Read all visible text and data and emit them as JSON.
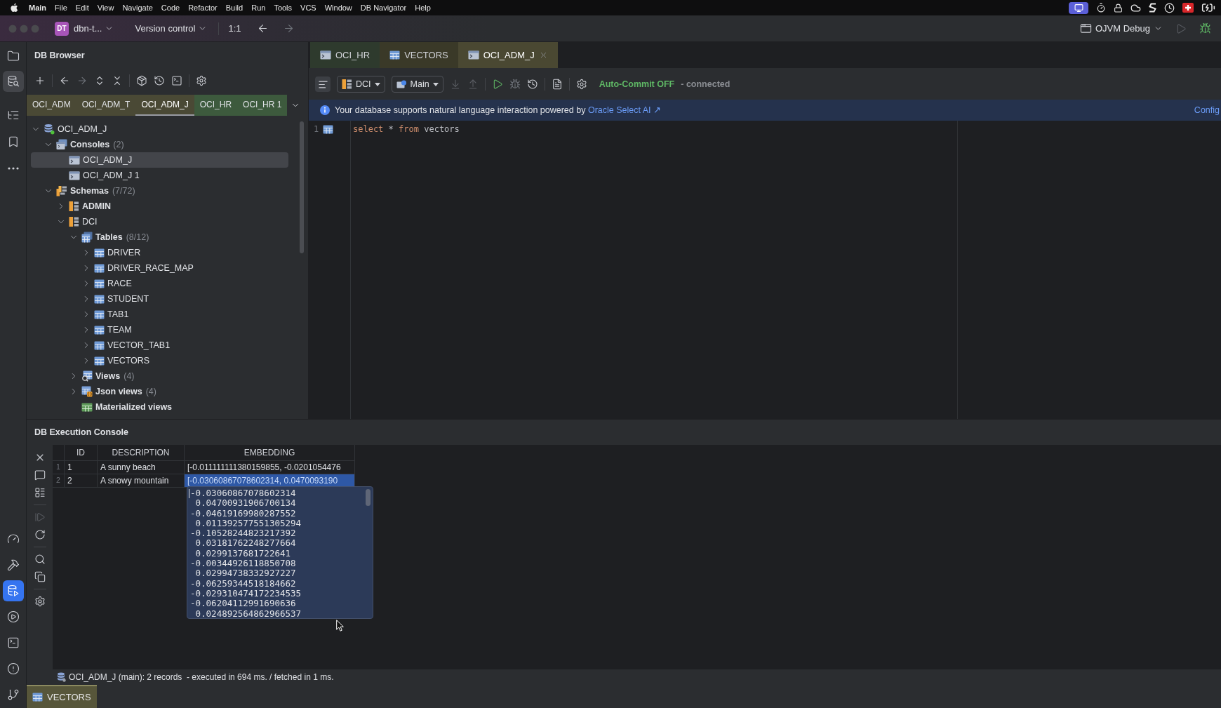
{
  "menu_bar": {
    "app": "Main",
    "items": [
      "File",
      "Edit",
      "View",
      "Navigate",
      "Code",
      "Refactor",
      "Build",
      "Run",
      "Tools",
      "VCS",
      "Window",
      "DB Navigator",
      "Help"
    ]
  },
  "toolbar": {
    "project_initials": "DT",
    "project": "dbn-t...",
    "vcs": "Version control",
    "position": "1:1",
    "run_config": "OJVM Debug"
  },
  "tool_strip": {
    "top": [
      {
        "kind": "project",
        "selected": false
      },
      {
        "kind": "db-browser",
        "selected": true
      },
      {
        "kind": "structure",
        "selected": false
      },
      {
        "kind": "bookmarks",
        "selected": false
      },
      {
        "kind": "more",
        "selected": false
      }
    ],
    "bottom": [
      {
        "kind": "profiler",
        "selected": false
      },
      {
        "kind": "build",
        "selected": false
      },
      {
        "kind": "db-console",
        "selected": true
      },
      {
        "kind": "services",
        "selected": false
      },
      {
        "kind": "terminal",
        "selected": false
      },
      {
        "kind": "problems",
        "selected": false
      },
      {
        "kind": "git",
        "selected": false
      }
    ]
  },
  "db_browser": {
    "title": "DB Browser",
    "connection_tabs": [
      {
        "label": "OCI_ADM",
        "selected": false,
        "color": "#4a4935"
      },
      {
        "label": "OCI_ADM_T",
        "selected": false,
        "color": "#4a4935"
      },
      {
        "label": "OCI_ADM_J",
        "selected": true,
        "color": "#4a4935"
      },
      {
        "label": "OCI_HR",
        "selected": false,
        "color": "#3d5a3d"
      },
      {
        "label": "OCI_HR 1",
        "selected": false,
        "color": "#3d5a3d"
      }
    ],
    "tree": [
      {
        "label": "OCI_ADM_J",
        "kind": "connection",
        "expanded": true,
        "selected": false,
        "children": [
          {
            "label": "Consoles",
            "count": "(2)",
            "kind": "consoles",
            "expanded": true,
            "selected": false,
            "children": [
              {
                "label": "OCI_ADM_J",
                "kind": "console",
                "selected": true
              },
              {
                "label": "OCI_ADM_J 1",
                "kind": "console",
                "selected": false
              }
            ]
          },
          {
            "label": "Schemas",
            "count": "(7/72)",
            "kind": "schemas",
            "expanded": true,
            "selected": false,
            "children": [
              {
                "label": "ADMIN",
                "kind": "schema",
                "bold": true,
                "expanded": false,
                "selected": false
              },
              {
                "label": "DCI",
                "kind": "schema",
                "bold": false,
                "expanded": true,
                "selected": false,
                "children": [
                  {
                    "label": "Tables",
                    "count": "(8/12)",
                    "kind": "tables",
                    "expanded": true,
                    "selected": false,
                    "children": [
                      {
                        "label": "DRIVER",
                        "kind": "table",
                        "expanded": false,
                        "selected": false
                      },
                      {
                        "label": "DRIVER_RACE_MAP",
                        "kind": "table",
                        "expanded": false,
                        "selected": false
                      },
                      {
                        "label": "RACE",
                        "kind": "table",
                        "expanded": false,
                        "selected": false
                      },
                      {
                        "label": "STUDENT",
                        "kind": "table",
                        "expanded": false,
                        "selected": false
                      },
                      {
                        "label": "TAB1",
                        "kind": "table",
                        "expanded": false,
                        "selected": false
                      },
                      {
                        "label": "TEAM",
                        "kind": "table",
                        "expanded": false,
                        "selected": false
                      },
                      {
                        "label": "VECTOR_TAB1",
                        "kind": "table",
                        "expanded": false,
                        "selected": false
                      },
                      {
                        "label": "VECTORS",
                        "kind": "table",
                        "expanded": false,
                        "selected": false
                      }
                    ]
                  },
                  {
                    "label": "Views",
                    "count": "(4)",
                    "kind": "views",
                    "expanded": false,
                    "selected": false
                  },
                  {
                    "label": "Json views",
                    "count": "(4)",
                    "kind": "json-views",
                    "expanded": false,
                    "selected": false
                  },
                  {
                    "label": "Materialized views",
                    "kind": "mviews",
                    "selected": false
                  }
                ]
              }
            ]
          }
        ]
      }
    ]
  },
  "editor_tabs": [
    {
      "label": "OCI_HR",
      "kind": "console",
      "selected": false,
      "color": "#2e3a2d"
    },
    {
      "label": "VECTORS",
      "kind": "table",
      "selected": false,
      "color": "#3a3928"
    },
    {
      "label": "OCI_ADM_J",
      "kind": "console",
      "selected": true,
      "color": "#4a4832"
    }
  ],
  "editor_toolbar": {
    "schema": "DCI",
    "session": "Main",
    "auto_commit": "Auto-Commit OFF",
    "connection_status": "- connected"
  },
  "banner": {
    "text": "Your database supports natural language interaction powered by",
    "link": "Oracle Select AI ↗",
    "action": "Config"
  },
  "editor": {
    "lines": [
      {
        "number": "1",
        "tokens": [
          {
            "text": "select",
            "kind": "keyword"
          },
          {
            "text": "*",
            "kind": "plain"
          },
          {
            "text": "from",
            "kind": "keyword"
          },
          {
            "text": "vectors",
            "kind": "plain"
          }
        ]
      }
    ]
  },
  "console": {
    "title": "DB Execution Console",
    "columns": [
      "ID",
      "DESCRIPTION",
      "EMBEDDING"
    ],
    "rows": [
      {
        "number": "1",
        "cells": [
          {
            "text": "1",
            "selected": false
          },
          {
            "text": "A sunny beach",
            "selected": false
          },
          {
            "text": "[-0.011111111380159855, -0.0201054476",
            "selected": false
          }
        ]
      },
      {
        "number": "2",
        "cells": [
          {
            "text": "2",
            "selected": false
          },
          {
            "text": "A snowy mountain",
            "selected": false
          },
          {
            "text": "[-0.03060867078602314, 0.0470093190",
            "selected": true
          }
        ]
      }
    ],
    "value_popup": {
      "lines": [
        "-0.03060867078602314",
        " 0.04700931906700134",
        "-0.04619169980287552",
        " 0.011392577551305294",
        "-0.10528244823217392",
        " 0.03181762248277664",
        " 0.0299137681722641",
        "-0.00344926118850708",
        " 0.02994738332927227",
        "-0.06259344518184662",
        "-0.029310474172234535",
        "-0.06204112991690636",
        " 0.024892564862966537"
      ]
    },
    "status": "OCI_ADM_J (main): 2 records  - executed in 694 ms. / fetched in 1 ms.",
    "tabs": [
      {
        "label": "VECTORS",
        "kind": "table",
        "selected": true,
        "color": "#57563a"
      }
    ]
  }
}
